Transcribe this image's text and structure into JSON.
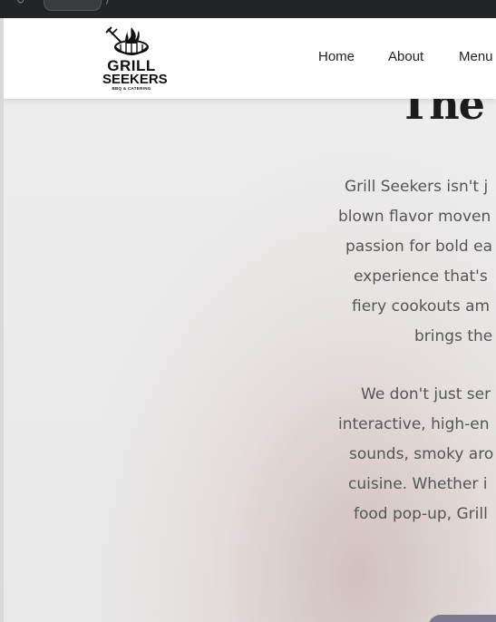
{
  "browser": {
    "address_text": "S.T.C",
    "slash": "/"
  },
  "logo": {
    "line1": "GRILL",
    "line2": "SEEKERS",
    "line3": "BBQ & CATERING"
  },
  "nav": {
    "home": "Home",
    "about": "About",
    "menu": "Menu"
  },
  "hero": {
    "title": "The G"
  },
  "paragraph1": [
    "Grill Seekers isn't j",
    "blown flavor moven",
    "passion for bold ea",
    "experience that's",
    "fiery cookouts am",
    "brings the"
  ],
  "paragraph2": [
    "We don't just ser",
    "interactive, high-en",
    "sounds, smoky aro",
    "cuisine. Whether i",
    "food pop-up, Grill"
  ]
}
